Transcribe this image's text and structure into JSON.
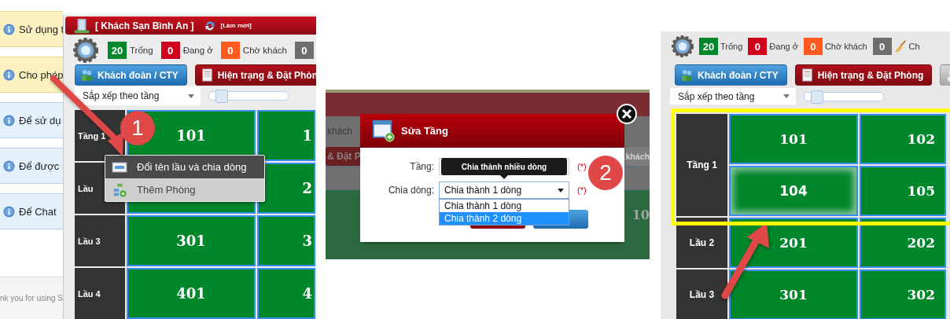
{
  "step_1": {
    "sidebar": [
      {
        "text": "Sử dụng t",
        "color": "#fbf2c0"
      },
      {
        "text": "Cho phép",
        "color": "#fbf2c0"
      },
      {
        "text": "Để sử dụ",
        "color": "#e4f1fb"
      },
      {
        "text": "Để được",
        "color": "#e4f1fb"
      },
      {
        "text": "Để Chat",
        "color": "#e4f1fb"
      }
    ],
    "footer": "nk you for using S",
    "hotel": {
      "title": "[ Khách Sạn Bình An ]",
      "refresh": "[Làm mới]"
    },
    "stats": [
      {
        "count": "20",
        "label": "Trống",
        "color": "#00862b"
      },
      {
        "count": "0",
        "label": "Đang ở",
        "color": "#d0021b"
      },
      {
        "count": "0",
        "label": "Chờ khách",
        "color": "#ff5a1f"
      },
      {
        "count": "0",
        "color": "#6e6e6e"
      }
    ],
    "buttons": [
      {
        "label": "Khách đoàn / CTY",
        "kind": "group"
      },
      {
        "label": "Hiện trạng & Đặt Phòn",
        "kind": "status"
      }
    ],
    "sort": {
      "value": "Sắp xếp theo tầng"
    },
    "zoom_slider": {
      "level": 0.08
    },
    "floors": [
      {
        "label": "Tầng 1",
        "rooms": [
          {
            "number": "101"
          },
          {
            "number": "1"
          }
        ]
      },
      {
        "label": "Lầu",
        "rooms": [
          {
            "number": "2"
          }
        ]
      },
      {
        "label": "Lầu 3",
        "rooms": [
          {
            "number": "301"
          },
          {
            "number": "3"
          }
        ]
      },
      {
        "label": "Lầu 4",
        "rooms": [
          {
            "number": "401"
          },
          {
            "number": "4"
          }
        ]
      }
    ],
    "context_menu": [
      {
        "label": "Đổi tên lầu và chia dòng",
        "selected": true
      },
      {
        "label": "Thêm Phòng",
        "selected": false
      }
    ],
    "step": "1"
  },
  "step_2": {
    "background": {
      "label": "khách",
      "left_button": "& Đặt P",
      "right_button": "khách",
      "room": "10"
    },
    "dialog": {
      "title": "Sửa Tầng",
      "floor_label": "Tầng:",
      "floor_required": "(*)",
      "tooltip": "Chia thành nhiều dòng",
      "rows_label": "Chia dòng:",
      "rows_value": "Chia thành 1 dòng",
      "rows_required": "(*)",
      "options": [
        {
          "label": "Chia thành 1 dòng",
          "selected": false
        },
        {
          "label": "Chia thành 2 dòng",
          "selected": true
        }
      ]
    },
    "step": "2"
  },
  "step_3": {
    "stats": [
      {
        "count": "20",
        "label": "Trống",
        "color": "#00862b"
      },
      {
        "count": "0",
        "label": "Đang ở",
        "color": "#d0021b"
      },
      {
        "count": "0",
        "label": "Chờ khách",
        "color": "#ff5a1f"
      },
      {
        "count": "0",
        "label": "Ch",
        "color": "#6e6e6e"
      }
    ],
    "buttons": [
      {
        "label": "Khách đoàn / CTY",
        "kind": "group"
      },
      {
        "label": "Hiện trạng & Đặt Phòng",
        "kind": "status"
      },
      {
        "kind": "person"
      }
    ],
    "sort": {
      "value": "Sắp xếp theo tầng"
    },
    "zoom_slider": {
      "level": 0.08
    },
    "floors": [
      {
        "label": "Tầng 1",
        "highlighted": true,
        "rows": [
          [
            {
              "number": "101",
              "selected": false
            },
            {
              "number": "102",
              "selected": false
            }
          ],
          [
            {
              "number": "104",
              "selected": true
            },
            {
              "number": "105",
              "selected": false
            }
          ]
        ]
      },
      {
        "label": "Lầu 2",
        "highlighted": false,
        "rows": [
          [
            {
              "number": "201",
              "selected": false
            },
            {
              "number": "202",
              "selected": false
            }
          ]
        ]
      },
      {
        "label": "Lầu 3",
        "highlighted": false,
        "rows": [
          [
            {
              "number": "301",
              "selected": false
            },
            {
              "number": "302",
              "selected": false
            }
          ]
        ]
      }
    ]
  }
}
